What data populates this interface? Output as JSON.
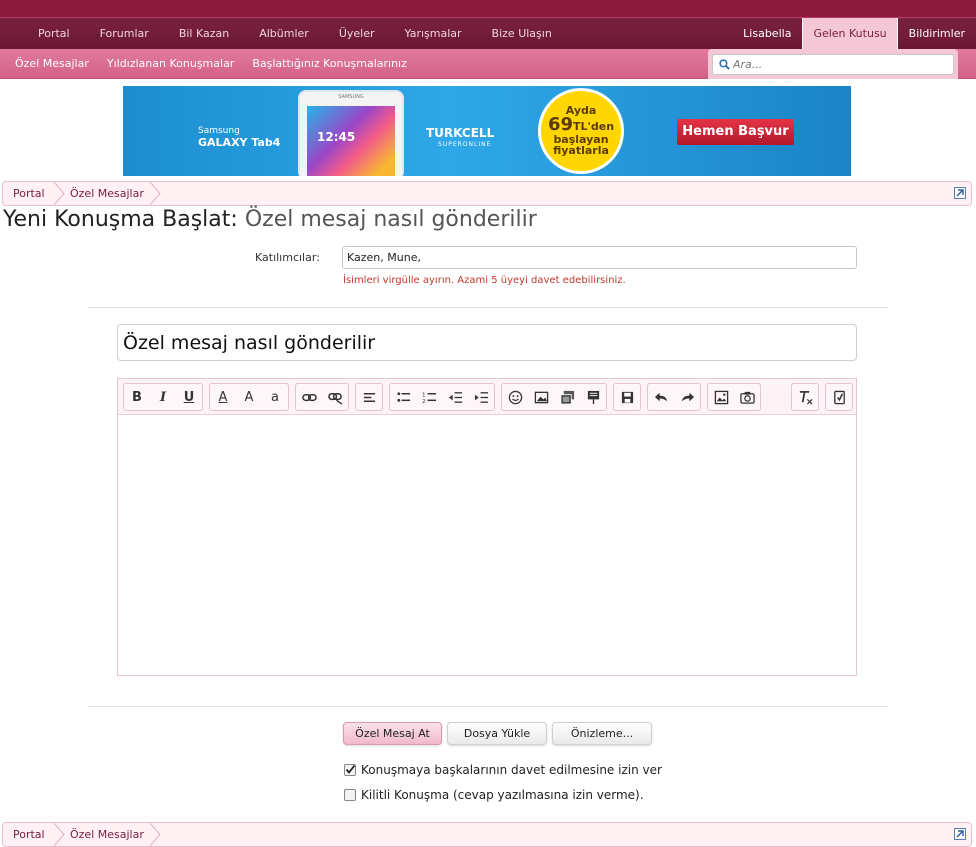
{
  "nav": {
    "tabs": [
      "Portal",
      "Forumlar",
      "Bil Kazan",
      "Albümler",
      "Üyeler",
      "Yarışmalar",
      "Bize Ulaşın"
    ],
    "user": "Lisabella",
    "inbox": "Gelen Kutusu",
    "alerts": "Bildirimler"
  },
  "subnav": [
    "Özel Mesajlar",
    "Yıldızlanan Konuşmalar",
    "Başlattığınız Konuşmalarınız"
  ],
  "search": {
    "placeholder": "Ara..."
  },
  "banner": {
    "brand_line1": "Samsung",
    "brand_line2": "GALAXY Tab4",
    "tablet_label": "SAMSUNG",
    "tablet_time": "12:45",
    "operator": "TURKCELL",
    "operator_sub": "SUPERONLINE",
    "promo_line1": "Ayda",
    "promo_price": "69",
    "promo_suffix": "TL'den",
    "promo_line3": "başlayan",
    "promo_line4": "fiyatlarla",
    "cta": "Hemen Başvur"
  },
  "breadcrumb": {
    "root": "Portal",
    "current": "Özel Mesajlar"
  },
  "page": {
    "title": "Yeni Konuşma Başlat:",
    "subtitle": "Özel mesaj nasıl gönderilir"
  },
  "form": {
    "participants_label": "Katılımcılar:",
    "participants_value": "Kazen, Mune,",
    "participants_hint": "İsimleri virgülle ayırın. Azami 5 üyeyi davet edebilirsiniz.",
    "subject_value": "Özel mesaj nasıl gönderilir",
    "message_body": ""
  },
  "toolbar": {
    "bold": "B",
    "italic": "I",
    "underline": "U",
    "font_color": "A",
    "font_size": "A",
    "font_family": "a"
  },
  "actions": {
    "submit": "Özel Mesaj At",
    "upload": "Dosya Yükle",
    "preview": "Önizleme..."
  },
  "options": {
    "allow_invite": {
      "label": "Konuşmaya başkalarının davet edilmesine izin ver",
      "checked": true
    },
    "locked": {
      "label": "Kilitli Konuşma (cevap yazılmasına izin verme).",
      "checked": false
    }
  },
  "colors": {
    "brand": "#7a2040",
    "accent": "#e27a9f",
    "hint": "#c0392b"
  }
}
